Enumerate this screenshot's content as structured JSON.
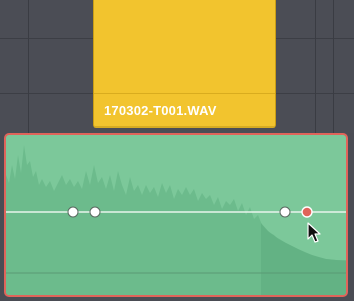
{
  "timeline": {
    "upper_clip": {
      "name": "170302-T001.WAV",
      "color": "#f2c42e"
    },
    "audio_clip": {
      "color": "#7cc89a",
      "selected_border_color": "#e0645a",
      "volume_keyframes": [
        {
          "id": "kf1",
          "selected": false
        },
        {
          "id": "kf2",
          "selected": false
        },
        {
          "id": "kf3",
          "selected": false
        },
        {
          "id": "kf4",
          "selected": true
        }
      ]
    }
  },
  "cursor": {
    "icon": "arrow-pointer-icon"
  }
}
